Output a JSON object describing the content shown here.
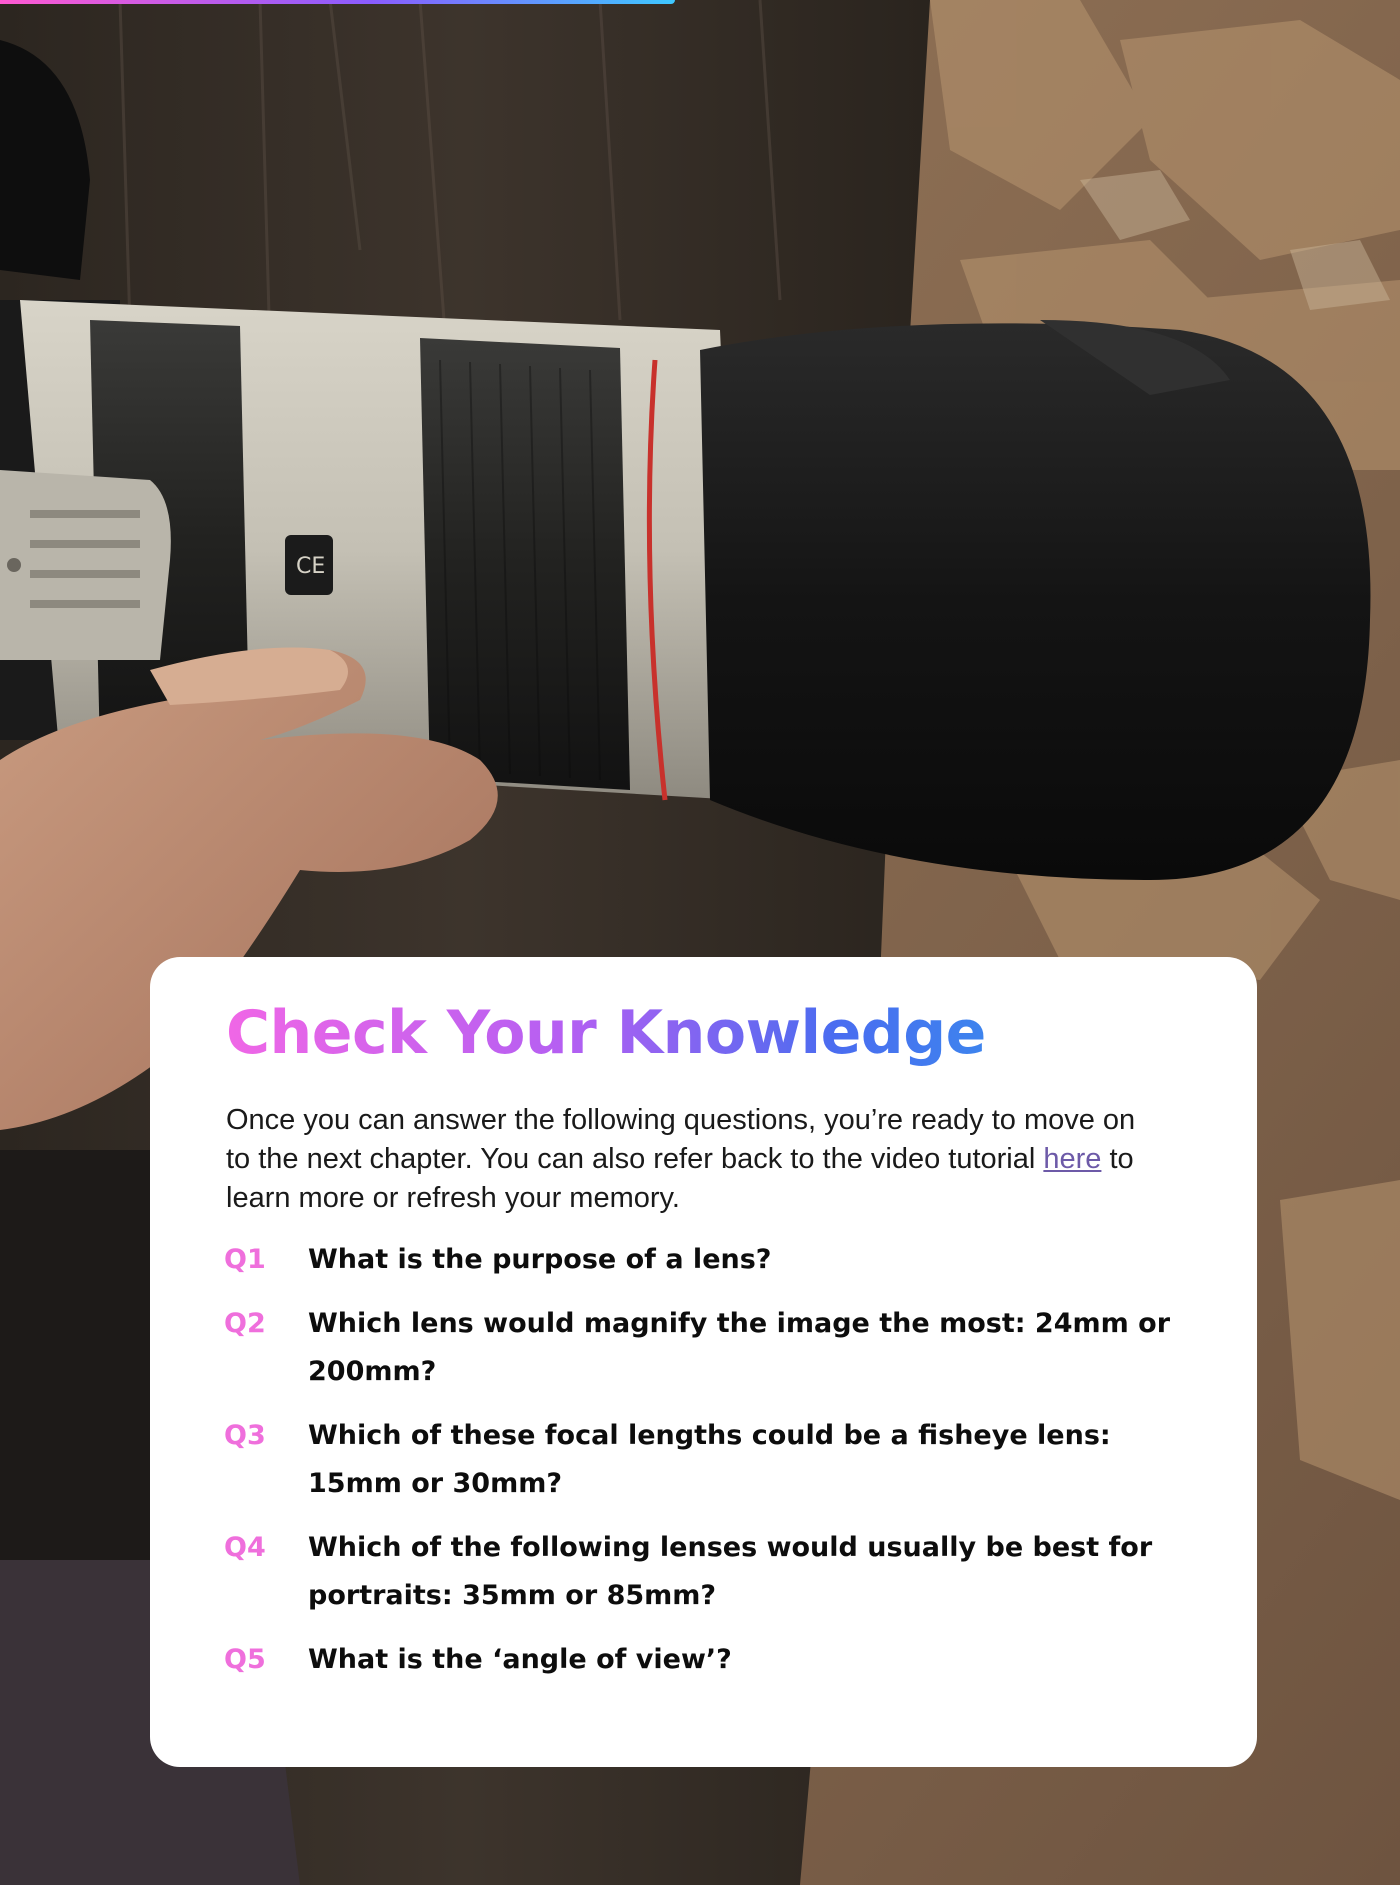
{
  "page": {
    "background_image": "camera-lens-photo",
    "accent_colors": {
      "pink": "#ef6fdc",
      "purple": "#8a5cff",
      "blue": "#3d84ee",
      "link": "#6d5aa8"
    }
  },
  "card": {
    "title": "Check Your Knowledge",
    "intro_before_link": "Once you can answer the following questions, you’re ready to move on to the next chapter. You can also refer back to the video tutorial ",
    "intro_link": "here",
    "intro_after_link": " to learn more or refresh your memory.",
    "questions": [
      {
        "num": "Q1",
        "text": "What is the purpose of a lens?"
      },
      {
        "num": "Q2",
        "text": "Which lens would magnify the image the most: 24mm or 200mm?"
      },
      {
        "num": "Q3",
        "text": "Which of these focal lengths could be a fisheye lens: 15mm or 30mm?"
      },
      {
        "num": "Q4",
        "text": "Which of the following lenses would usually be best for portraits: 35mm or 85mm?"
      },
      {
        "num": "Q5",
        "text": "What is the ‘angle of view’?"
      }
    ]
  }
}
